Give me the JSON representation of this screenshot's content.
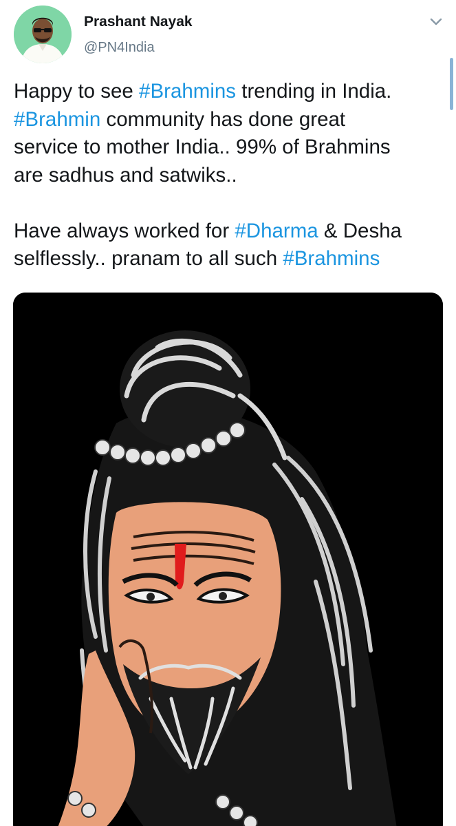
{
  "author": {
    "name": "Prashant Nayak",
    "handle": "@PN4India",
    "avatar_icon": "user-avatar"
  },
  "menu": {
    "icon": "chevron-down-icon"
  },
  "tweet": {
    "lines": [
      [
        {
          "t": "Happy to see "
        },
        {
          "t": "#Brahmins",
          "h": true
        },
        {
          "t": " trending in India."
        }
      ],
      [
        {
          "t": "#Brahmin",
          "h": true
        },
        {
          "t": " community has done great"
        }
      ],
      [
        {
          "t": "service to mother India.. 99% of Brahmins"
        }
      ],
      [
        {
          "t": "are sadhus and satwiks.."
        }
      ],
      [],
      [
        {
          "t": "Have always worked for "
        },
        {
          "t": "#Dharma",
          "h": true
        },
        {
          "t": " & Desha"
        }
      ],
      [
        {
          "t": "selflessly.. pranam to all such "
        },
        {
          "t": "#Brahmins",
          "h": true
        }
      ]
    ]
  },
  "media": {
    "type": "illustration"
  },
  "colors": {
    "hashtag": "#1b95e0",
    "text": "#14171a",
    "secondary": "#657786",
    "media_bg": "#000000",
    "skin": "#e8a07a",
    "tilak": "#e01c1c"
  }
}
